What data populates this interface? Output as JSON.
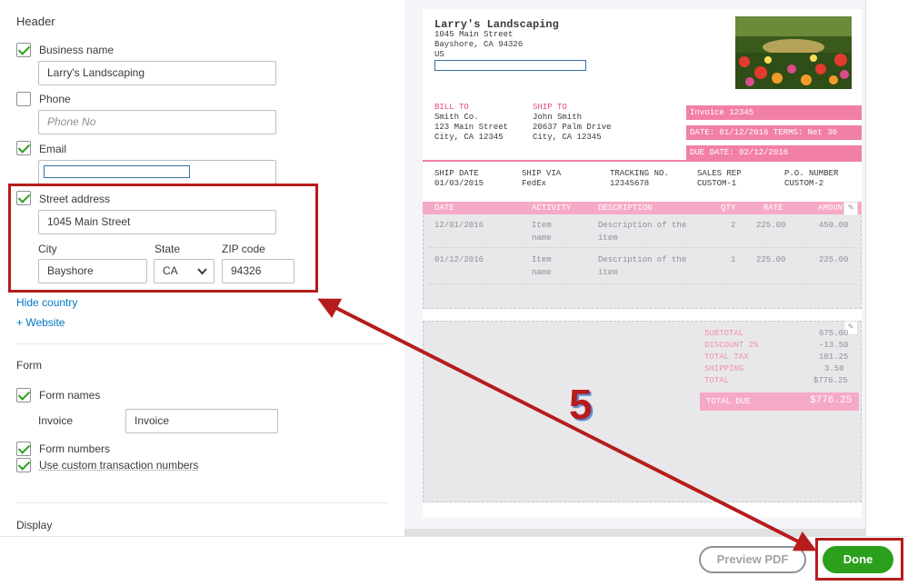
{
  "header": {
    "section_title": "Header",
    "business_name": {
      "label": "Business name",
      "checked": true,
      "value": "Larry's Landscaping"
    },
    "phone": {
      "label": "Phone",
      "checked": false,
      "placeholder": "Phone No"
    },
    "email": {
      "label": "Email",
      "checked": true,
      "value": ""
    },
    "street_address": {
      "label": "Street address",
      "checked": true,
      "value": "1045 Main Street",
      "city_label": "City",
      "city": "Bayshore",
      "state_label": "State",
      "state": "CA",
      "zip_label": "ZIP code",
      "zip": "94326"
    },
    "hide_country": "Hide country",
    "add_website": "+ Website"
  },
  "form": {
    "section_title": "Form",
    "form_names": {
      "label": "Form names",
      "checked": true,
      "invoice_label": "Invoice",
      "invoice_value": "Invoice"
    },
    "form_numbers": {
      "label": "Form numbers",
      "checked": true
    },
    "custom_txn": {
      "label": "Use custom transaction numbers",
      "checked": true
    }
  },
  "display": {
    "section_title": "Display"
  },
  "preview": {
    "company": "Larry's Landscaping",
    "address1": "1045 Main Street",
    "address2": "Bayshore, CA 94326",
    "country": "US",
    "bill_to_label": "BILL TO",
    "bill_to": [
      "Smith Co.",
      "123 Main Street",
      "City, CA 12345"
    ],
    "ship_to_label": "SHIP TO",
    "ship_to": [
      "John Smith",
      "20637 Palm Drive",
      "City, CA 12345"
    ],
    "invoice_no": "Invoice 12345",
    "date_terms": "DATE: 01/12/2016 TERMS: Net 30",
    "due_date": "DUE DATE: 02/12/2016",
    "ship_fields": [
      {
        "label": "SHIP DATE",
        "value": "01/03/2015"
      },
      {
        "label": "SHIP VIA",
        "value": "FedEx"
      },
      {
        "label": "TRACKING NO.",
        "value": "12345678"
      },
      {
        "label": "SALES REP",
        "value": "CUSTOM-1"
      },
      {
        "label": "P.O. NUMBER",
        "value": "CUSTOM-2"
      }
    ],
    "table_headers": [
      "DATE",
      "ACTIVITY",
      "DESCRIPTION",
      "QTY",
      "RATE",
      "AMOUNT"
    ],
    "rows": [
      {
        "date": "12/01/2016",
        "activity1": "Item",
        "activity2": "name",
        "desc1": "Description of the",
        "desc2": "item",
        "qty": "2",
        "rate": "225.00",
        "amount": "450.00"
      },
      {
        "date": "01/12/2016",
        "activity1": "Item",
        "activity2": "name",
        "desc1": "Description of the",
        "desc2": "item",
        "qty": "1",
        "rate": "225.00",
        "amount": "225.00"
      }
    ],
    "totals": [
      {
        "label": "SUBTOTAL",
        "value": "675.00"
      },
      {
        "label": "DISCOUNT 2%",
        "value": "-13.50"
      },
      {
        "label": "TOTAL TAX",
        "value": "101.25"
      },
      {
        "label": "SHIPPING",
        "value": "3.50"
      },
      {
        "label": "TOTAL",
        "value": "$776.25"
      }
    ],
    "total_due_label": "TOTAL DUE",
    "total_due_value": "$776.25"
  },
  "footer": {
    "preview_pdf": "Preview PDF",
    "done": "Done"
  },
  "annotation": {
    "step": "5"
  },
  "colors": {
    "accent_green": "#2ca01c",
    "link_blue": "#0077c5",
    "preview_pink": "#f27fa8",
    "annotation_red": "#b71c1c"
  }
}
